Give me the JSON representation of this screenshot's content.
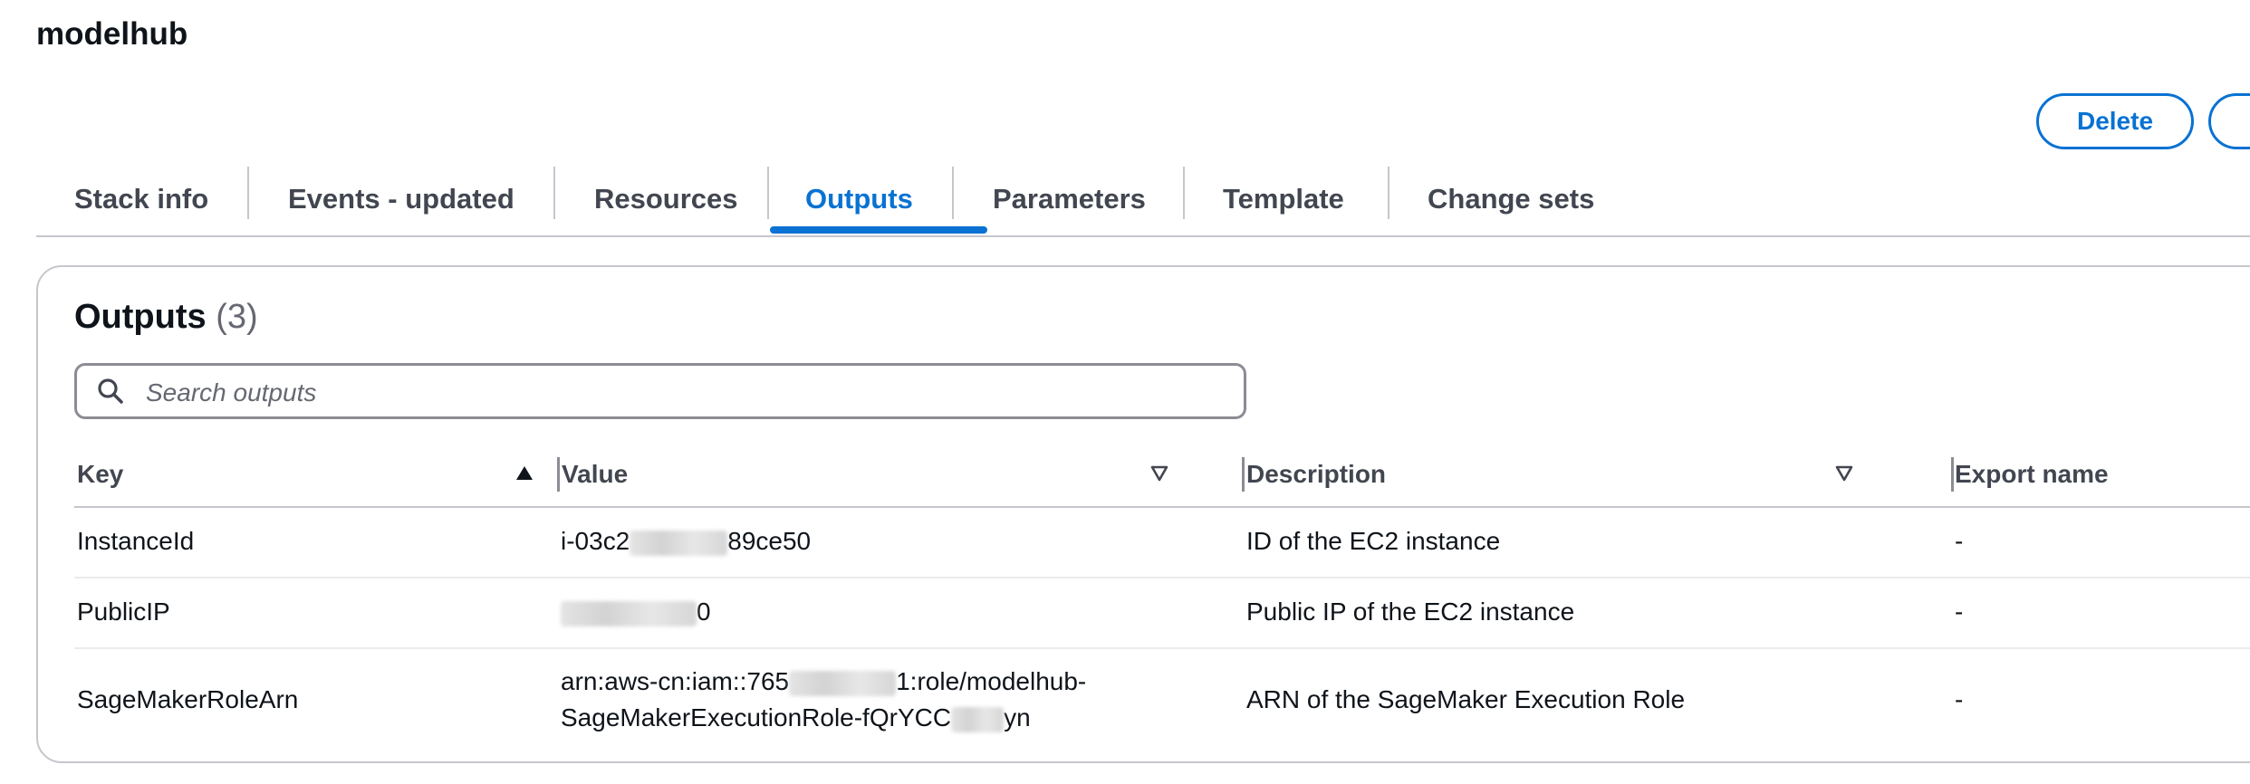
{
  "stack": {
    "title": "modelhub"
  },
  "actions": {
    "delete_label": "Delete"
  },
  "tabs": [
    {
      "label": "Stack info"
    },
    {
      "label": "Events - updated"
    },
    {
      "label": "Resources"
    },
    {
      "label": "Outputs",
      "active": true
    },
    {
      "label": "Parameters"
    },
    {
      "label": "Template"
    },
    {
      "label": "Change sets"
    }
  ],
  "outputs": {
    "title": "Outputs",
    "count": "(3)",
    "search_placeholder": "Search outputs",
    "columns": {
      "key": "Key",
      "value": "Value",
      "description": "Description",
      "export_name": "Export name"
    },
    "rows": [
      {
        "key": "InstanceId",
        "value_start": "i-03c2",
        "value_end": "89ce50",
        "description": "ID of the EC2 instance",
        "export_name": "-"
      },
      {
        "key": "PublicIP",
        "value_end": "0",
        "description": "Public IP of the EC2 instance",
        "export_name": "-"
      },
      {
        "key": "SageMakerRoleArn",
        "value_line1_start": "arn:aws-cn:iam::765",
        "value_line1_end": "1:role/modelhub-",
        "value_line2_start": "SageMakerExecutionRole-fQrYCC",
        "value_line2_end": "yn",
        "description": "ARN of the SageMaker Execution Role",
        "export_name": "-"
      }
    ]
  },
  "colors": {
    "accent": "#0972d3",
    "border": "#c6c6cd",
    "text": "#0f141a",
    "muted": "#424650"
  },
  "icons": {
    "search": "search-icon",
    "sort_asc": "sort-ascending-icon",
    "sort_desc": "sort-descending-icon"
  }
}
